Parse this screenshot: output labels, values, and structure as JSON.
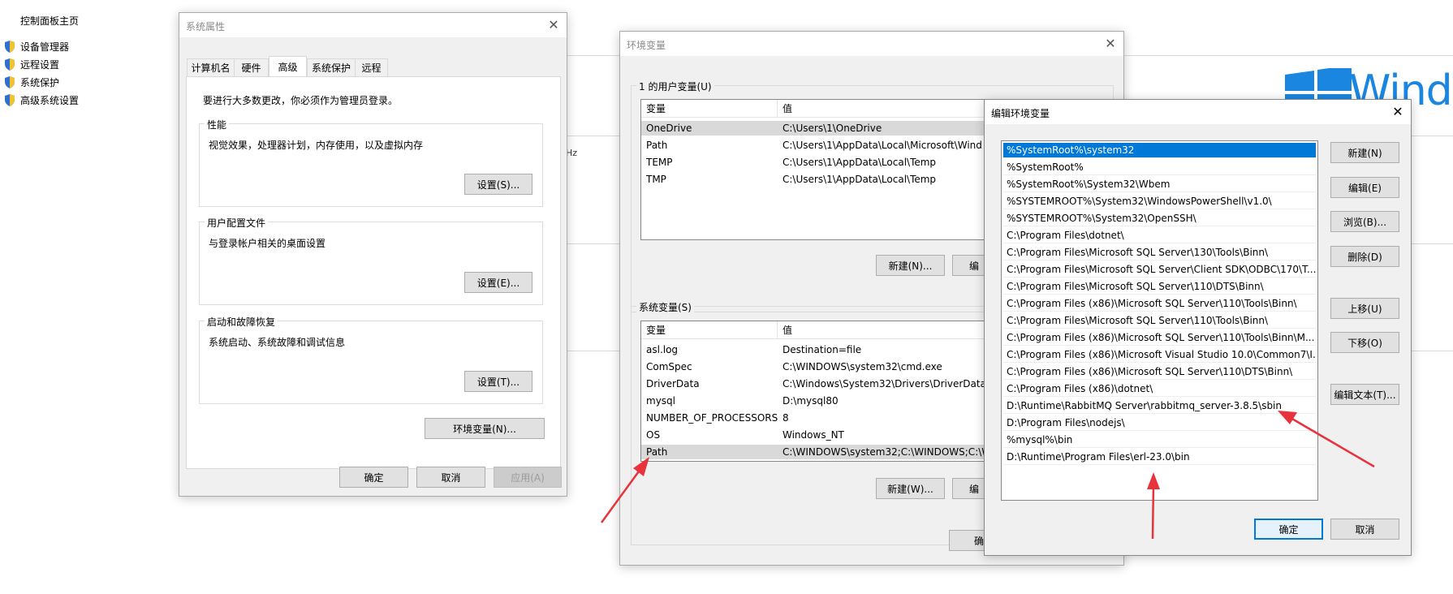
{
  "control_panel": {
    "home": "控制面板主页",
    "links": [
      "设备管理器",
      "远程设置",
      "系统保护",
      "高级系统设置"
    ],
    "fragment": "Hz",
    "brand_text": "Windo"
  },
  "system_properties": {
    "title": "系统属性",
    "tabs": [
      "计算机名",
      "硬件",
      "高级",
      "系统保护",
      "远程"
    ],
    "admin_note": "要进行大多数更改，你必须作为管理员登录。",
    "groups": [
      {
        "legend": "性能",
        "desc": "视觉效果，处理器计划，内存使用，以及虚拟内存",
        "button": "设置(S)..."
      },
      {
        "legend": "用户配置文件",
        "desc": "与登录帐户相关的桌面设置",
        "button": "设置(E)..."
      },
      {
        "legend": "启动和故障恢复",
        "desc": "系统启动、系统故障和调试信息",
        "button": "设置(T)..."
      }
    ],
    "env_button": "环境变量(N)...",
    "ok": "确定",
    "cancel": "取消",
    "apply": "应用(A)"
  },
  "env_vars": {
    "title": "环境变量",
    "user_label": "1 的用户变量(U)",
    "col_var": "变量",
    "col_val": "值",
    "user_vars": [
      {
        "name": "OneDrive",
        "value": "C:\\Users\\1\\OneDrive"
      },
      {
        "name": "Path",
        "value": "C:\\Users\\1\\AppData\\Local\\Microsoft\\Wind"
      },
      {
        "name": "TEMP",
        "value": "C:\\Users\\1\\AppData\\Local\\Temp"
      },
      {
        "name": "TMP",
        "value": "C:\\Users\\1\\AppData\\Local\\Temp"
      }
    ],
    "user_new": "新建(N)...",
    "user_edit": "编",
    "system_label": "系统变量(S)",
    "system_vars": [
      {
        "name": "asl.log",
        "value": "Destination=file"
      },
      {
        "name": "ComSpec",
        "value": "C:\\WINDOWS\\system32\\cmd.exe"
      },
      {
        "name": "DriverData",
        "value": "C:\\Windows\\System32\\Drivers\\DriverData"
      },
      {
        "name": "mysql",
        "value": "D:\\mysql80"
      },
      {
        "name": "NUMBER_OF_PROCESSORS",
        "value": "8"
      },
      {
        "name": "OS",
        "value": "Windows_NT"
      },
      {
        "name": "Path",
        "value": "C:\\WINDOWS\\system32;C:\\WINDOWS;C:\\W"
      }
    ],
    "sys_new": "新建(W)...",
    "sys_edit": "编",
    "ok_partial": "确"
  },
  "edit_env": {
    "title": "编辑环境变量",
    "paths": [
      "%SystemRoot%\\system32",
      "%SystemRoot%",
      "%SystemRoot%\\System32\\Wbem",
      "%SYSTEMROOT%\\System32\\WindowsPowerShell\\v1.0\\",
      "%SYSTEMROOT%\\System32\\OpenSSH\\",
      "C:\\Program Files\\dotnet\\",
      "C:\\Program Files\\Microsoft SQL Server\\130\\Tools\\Binn\\",
      "C:\\Program Files\\Microsoft SQL Server\\Client SDK\\ODBC\\170\\T...",
      "C:\\Program Files\\Microsoft SQL Server\\110\\DTS\\Binn\\",
      "C:\\Program Files (x86)\\Microsoft SQL Server\\110\\Tools\\Binn\\",
      "C:\\Program Files\\Microsoft SQL Server\\110\\Tools\\Binn\\",
      "C:\\Program Files (x86)\\Microsoft SQL Server\\110\\Tools\\Binn\\M...",
      "C:\\Program Files (x86)\\Microsoft Visual Studio 10.0\\Common7\\I...",
      "C:\\Program Files (x86)\\Microsoft SQL Server\\110\\DTS\\Binn\\",
      "C:\\Program Files (x86)\\dotnet\\",
      "D:\\Runtime\\RabbitMQ Server\\rabbitmq_server-3.8.5\\sbin",
      "D:\\Program Files\\nodejs\\",
      "%mysql%\\bin",
      "D:\\Runtime\\Program Files\\erl-23.0\\bin"
    ],
    "buttons": {
      "new": "新建(N)",
      "edit": "编辑(E)",
      "browse": "浏览(B)...",
      "delete": "删除(D)",
      "up": "上移(U)",
      "down": "下移(O)",
      "edit_text": "编辑文本(T)..."
    },
    "ok": "确定",
    "cancel": "取消"
  },
  "colors": {
    "selection": "#0078d7",
    "annotation_arrow": "#e8323c",
    "windows_brand": "#1a86e0"
  }
}
